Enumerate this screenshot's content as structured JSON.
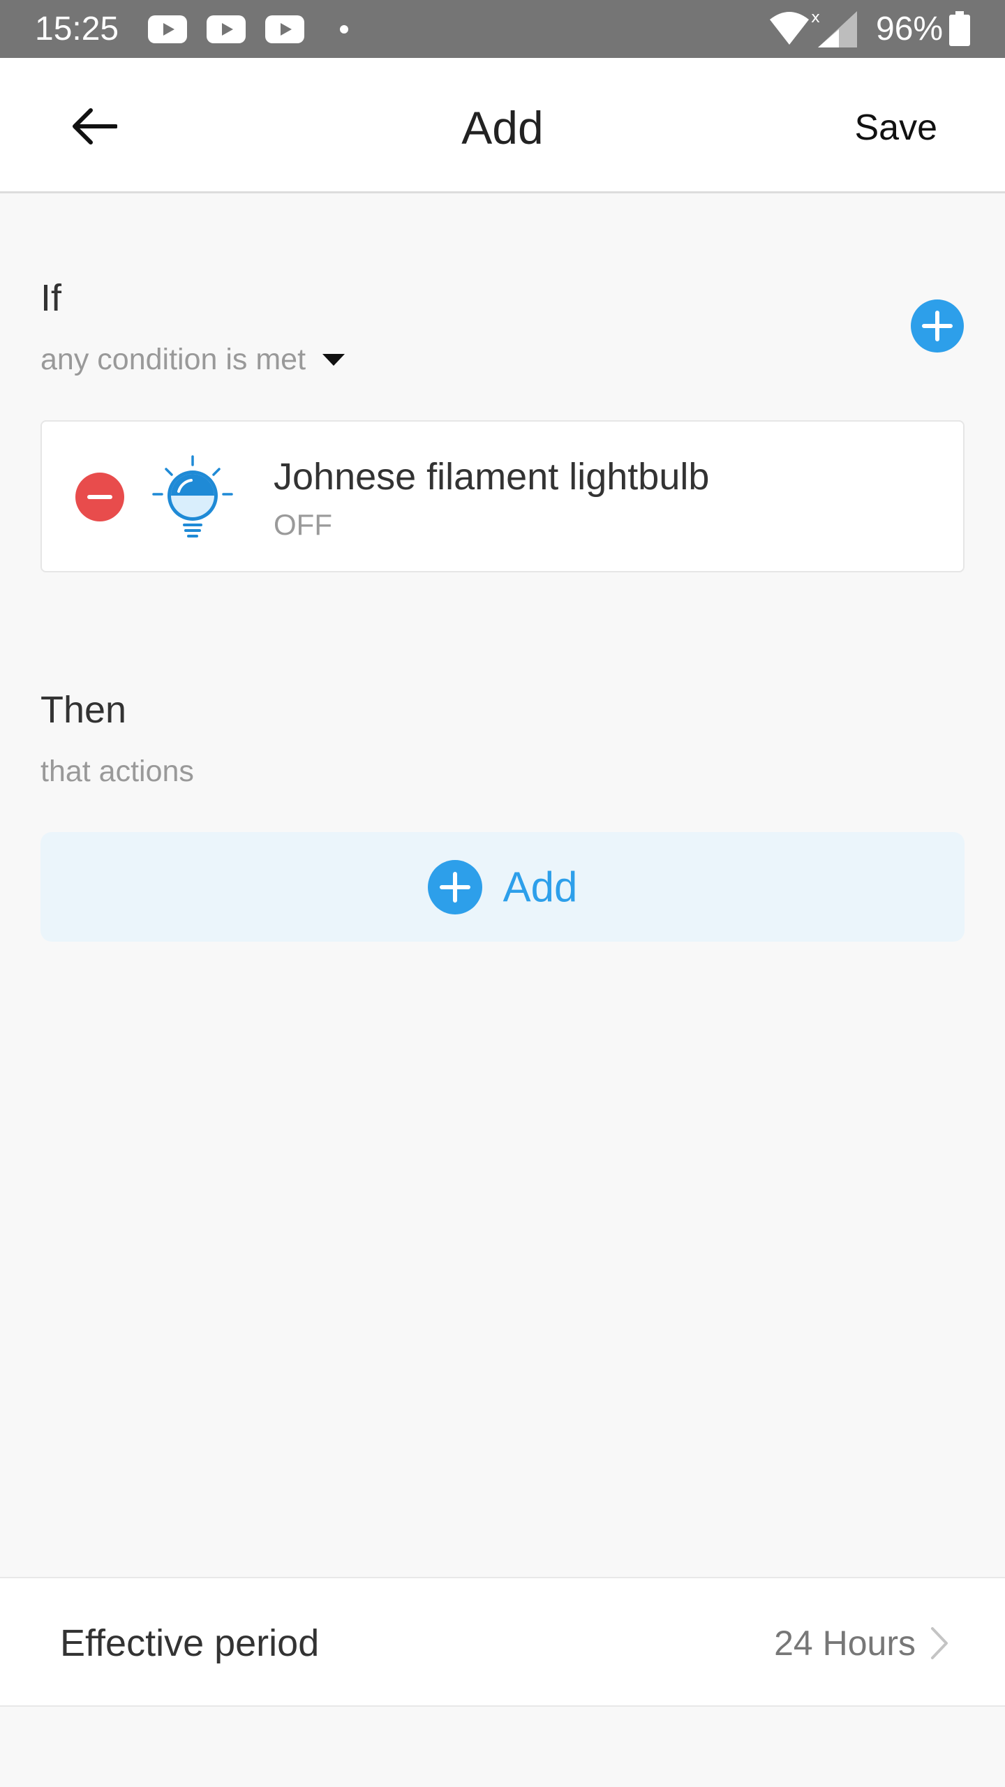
{
  "status_bar": {
    "time": "15:25",
    "battery": "96%",
    "notification_icons": [
      "youtube-icon",
      "youtube-icon",
      "youtube-icon",
      "dot-icon"
    ]
  },
  "header": {
    "title": "Add",
    "save_label": "Save",
    "back_icon": "arrow-left-icon"
  },
  "condition_section": {
    "title": "If",
    "mode": "any condition is met",
    "conditions": [
      {
        "device": "Johnese filament lightbulb",
        "state": "OFF",
        "icon": "lightbulb-icon"
      }
    ]
  },
  "action_section": {
    "title": "Then",
    "subtitle": "that actions",
    "add_label": "Add"
  },
  "effective_period": {
    "label": "Effective period",
    "value": "24 Hours"
  },
  "colors": {
    "accent": "#2d9fea",
    "remove": "#e84c4c",
    "status_bar": "#757575",
    "background": "#f8f8f8"
  }
}
